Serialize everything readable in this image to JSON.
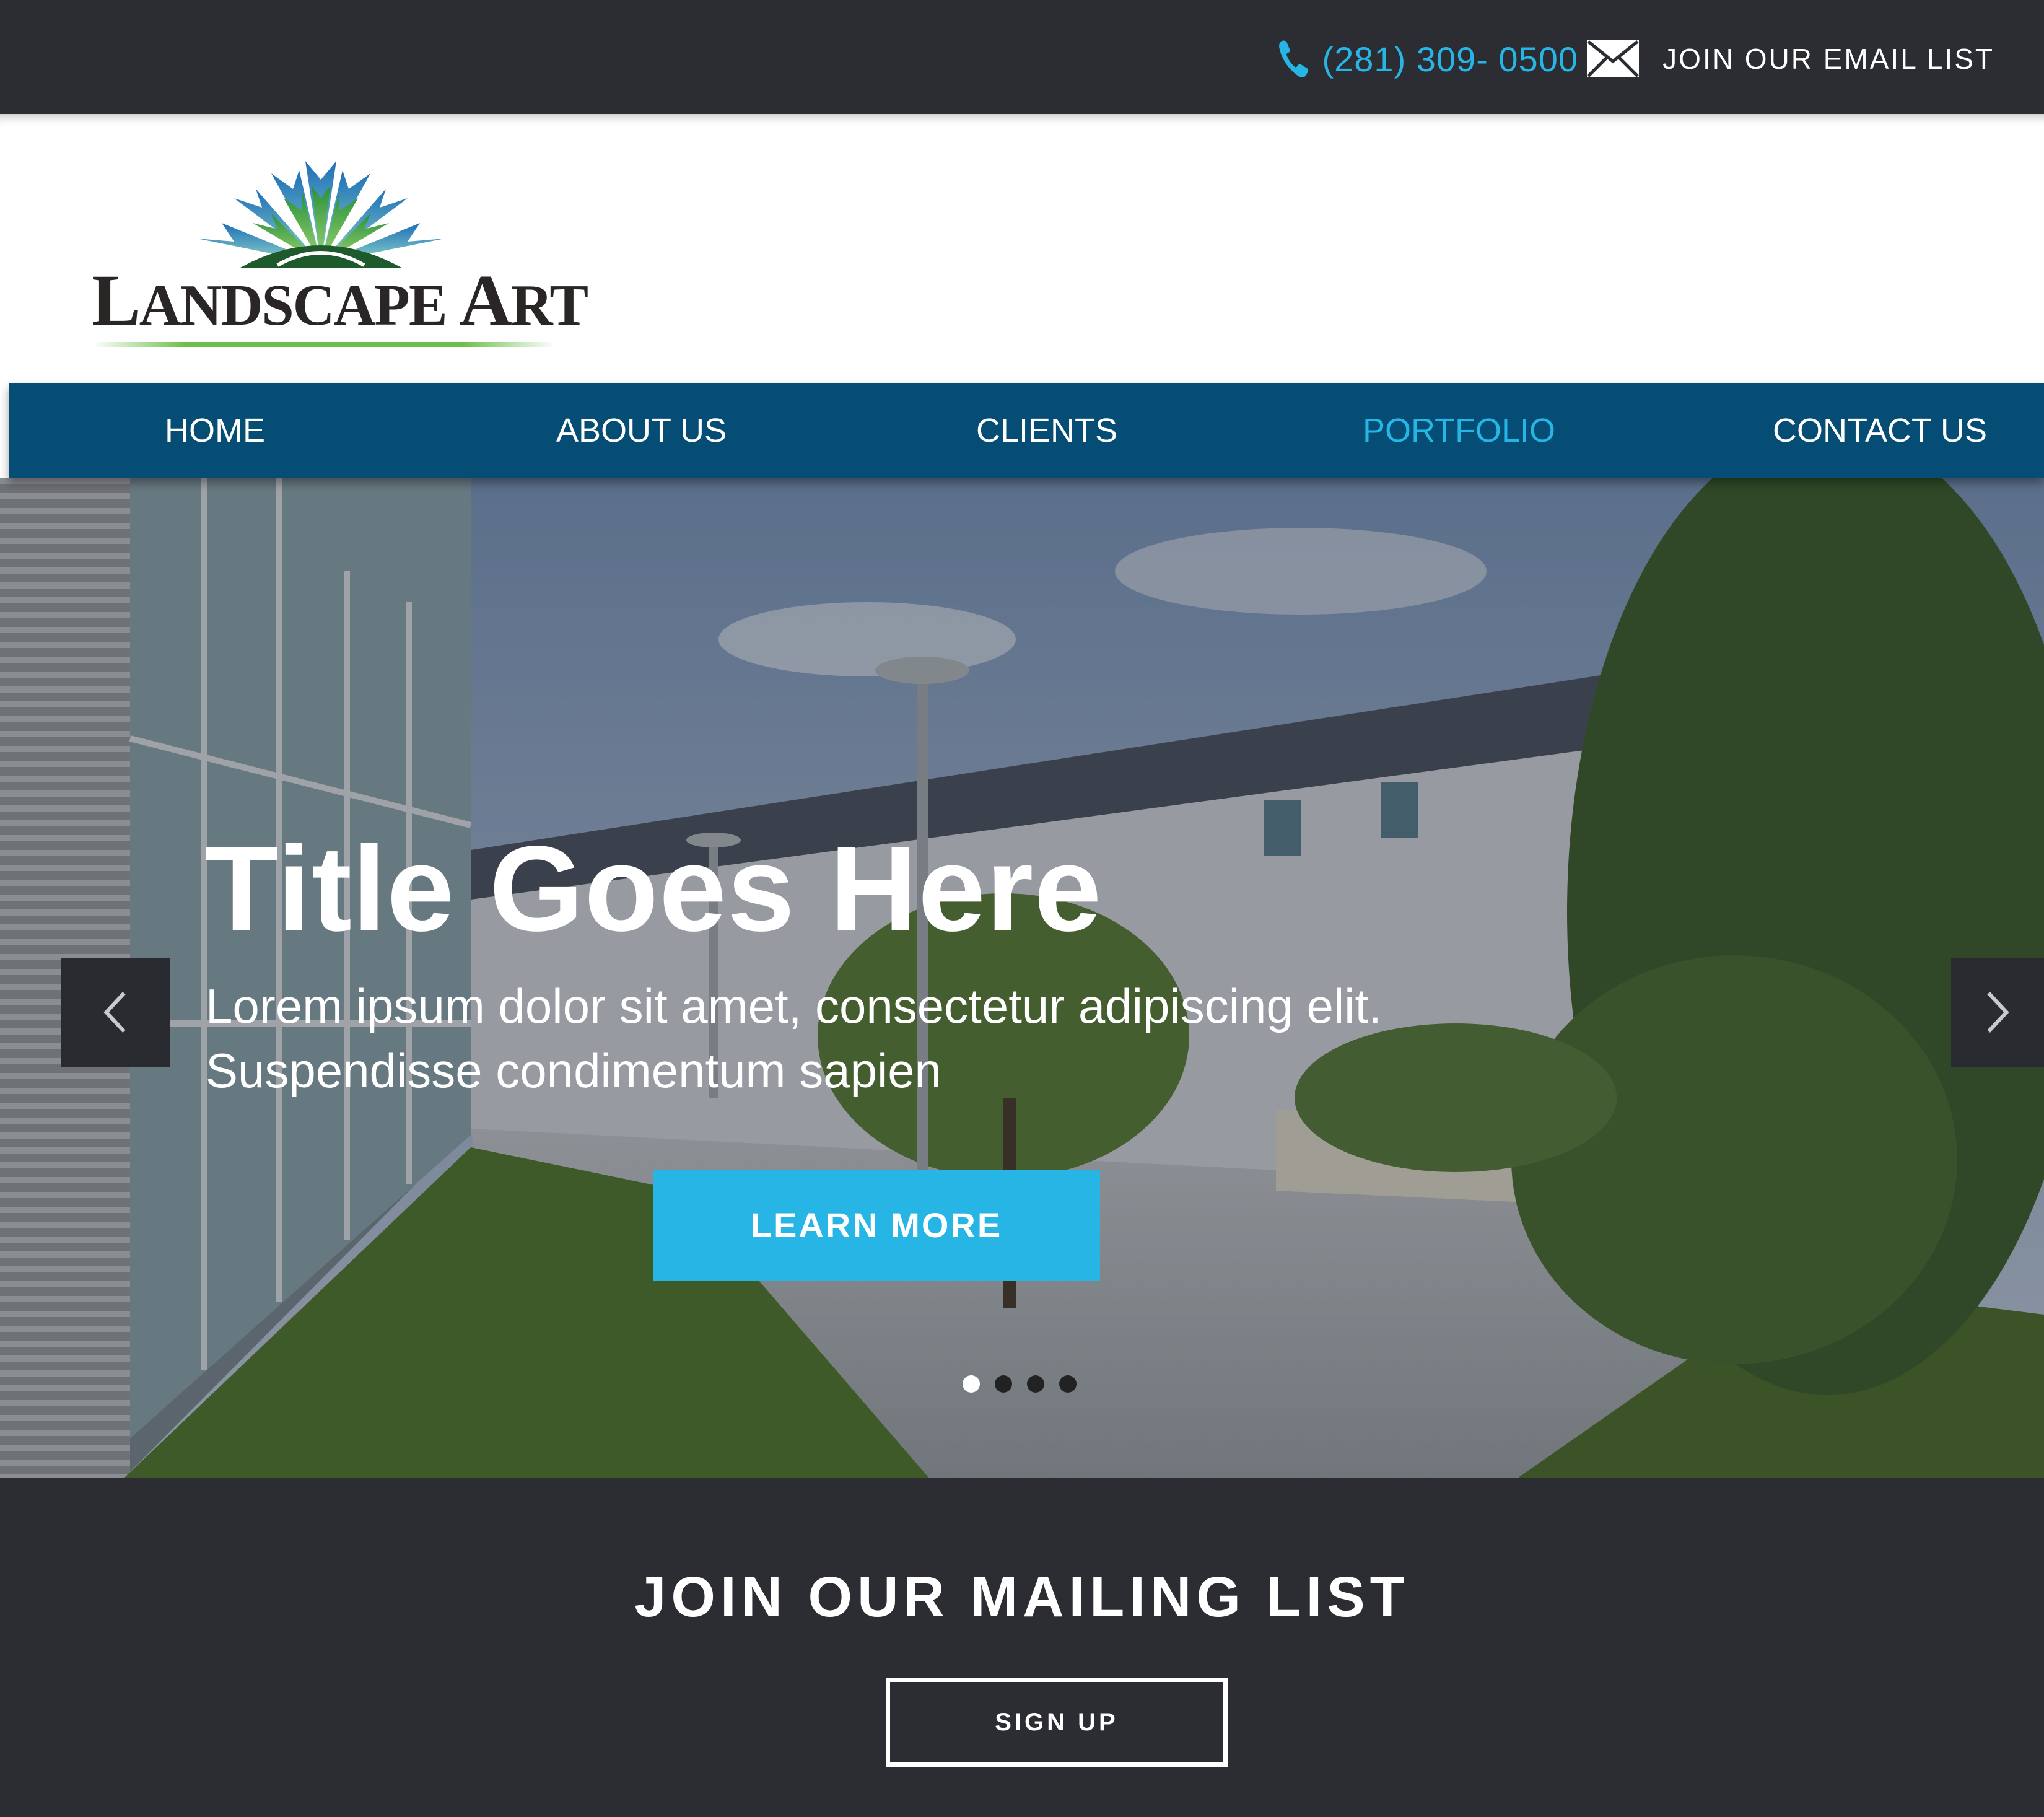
{
  "topbar": {
    "phone": "(281) 309- 0500",
    "phone_icon": "phone-icon",
    "email_label": "JOIN OUR EMAIL LIST",
    "email_icon": "envelope-icon"
  },
  "logo": {
    "text_large_1": "L",
    "text_small_1": "ANDSCAPE",
    "text_large_2": " A",
    "text_small_2": "RT"
  },
  "nav": {
    "items": [
      {
        "label": "HOME"
      },
      {
        "label": "ABOUT US"
      },
      {
        "label": "CLIENTS"
      },
      {
        "label": "PORTFOLIO"
      },
      {
        "label": "CONTACT US"
      }
    ],
    "active": "PORTFOLIO"
  },
  "hero": {
    "title": "Title Goes Here",
    "text": "Lorem ipsum dolor sit amet, consectetur adipiscing elit. Suspendisse condimentum sapien",
    "button": "LEARN MORE",
    "prev_icon": "chevron-left-icon",
    "next_icon": "chevron-right-icon",
    "slides": 4,
    "active_slide": 1
  },
  "mailing": {
    "title": "JOIN OUR MAILING LIST",
    "button": "SIGN UP"
  },
  "colors": {
    "dark_bar": "#2c2d33",
    "nav_blue": "#054d74",
    "accent": "#27b5e6"
  }
}
